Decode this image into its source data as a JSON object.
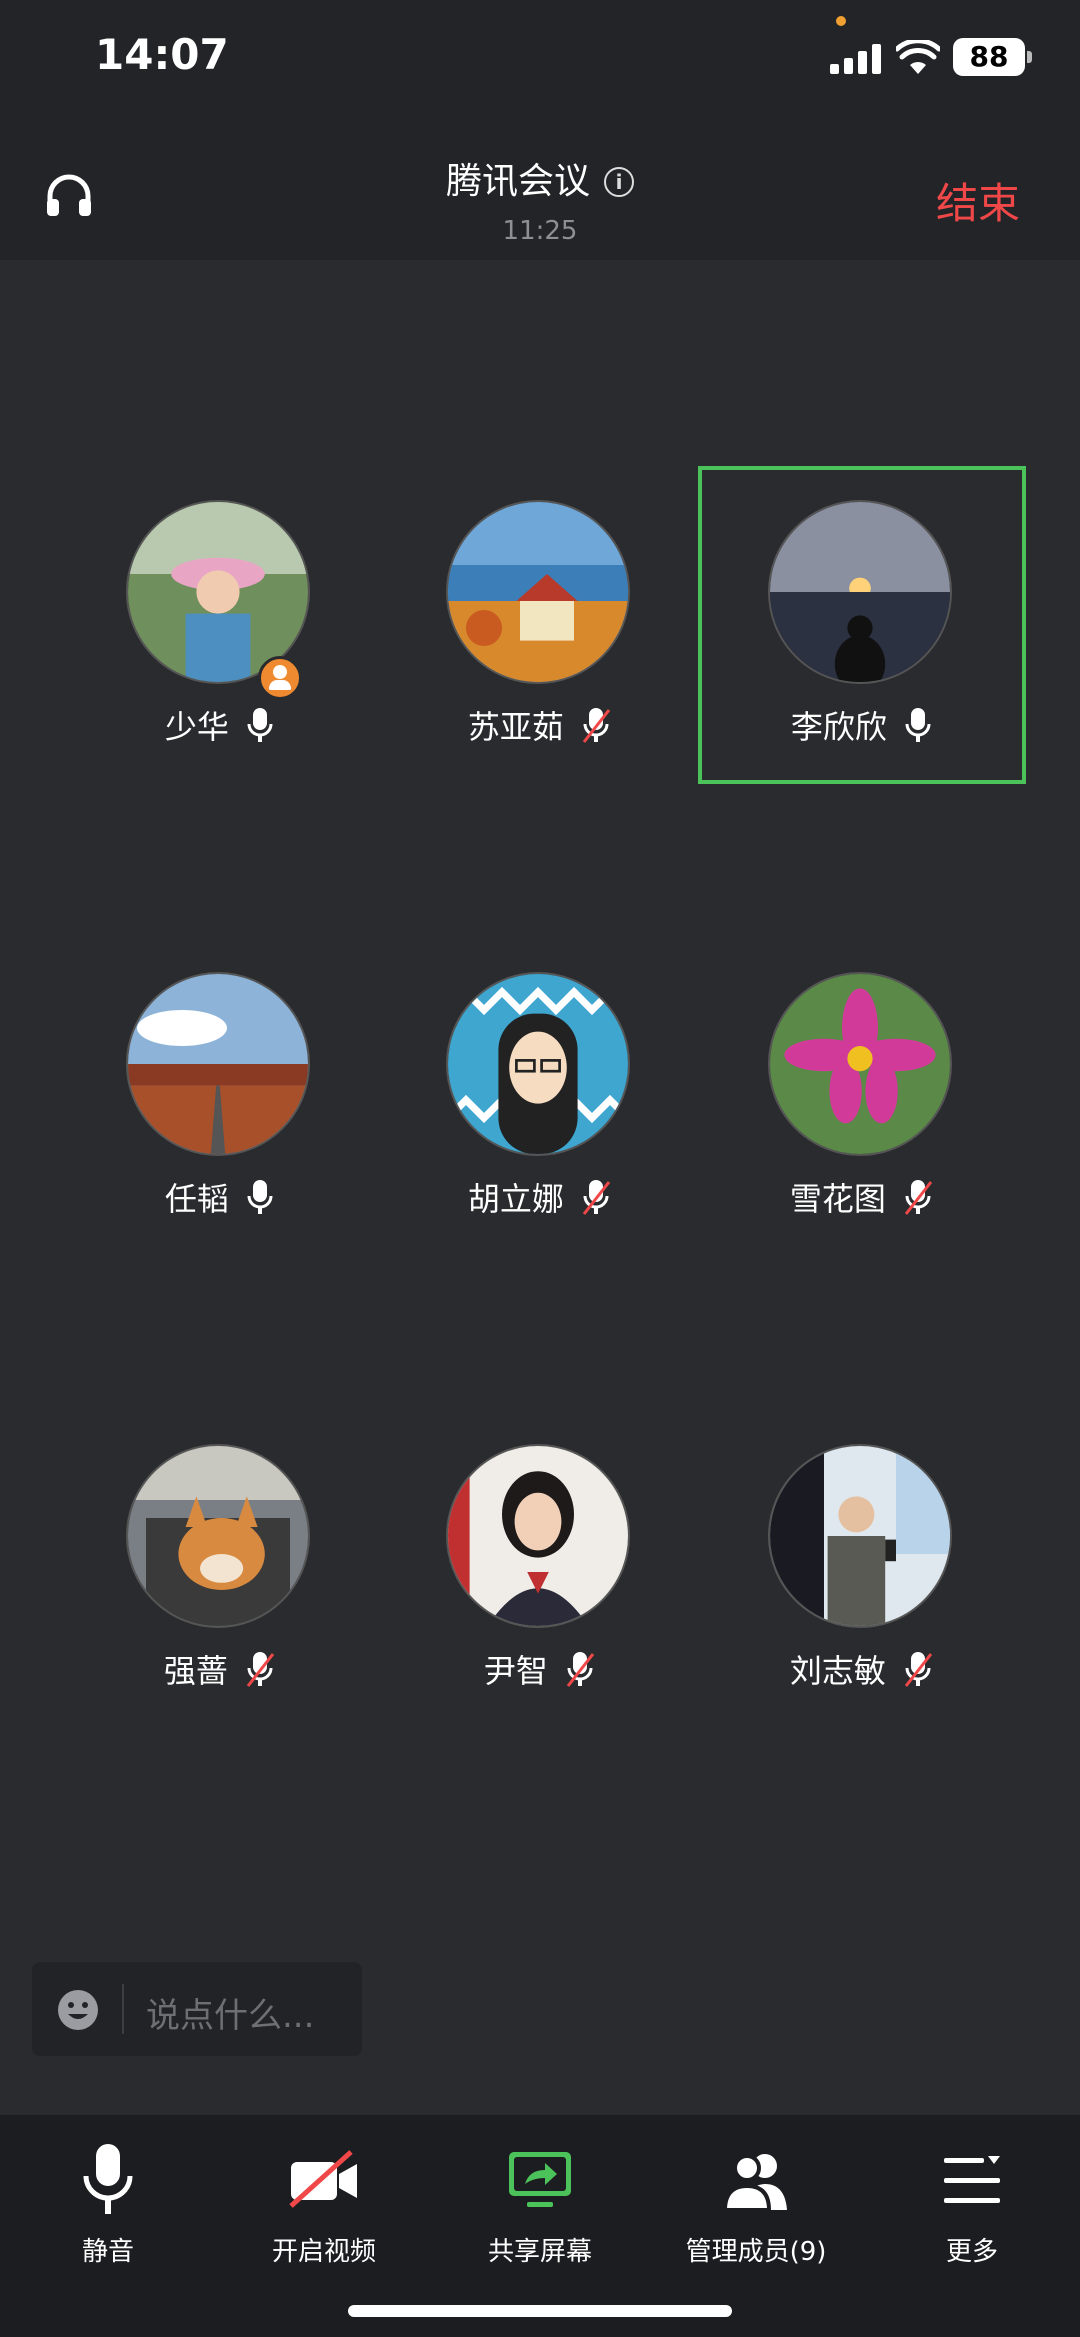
{
  "status": {
    "time": "14:07",
    "battery": "88"
  },
  "header": {
    "title": "腾讯会议",
    "duration": "11:25",
    "end_label": "结束"
  },
  "members": [
    {
      "name": "少华",
      "muted": false,
      "host": true,
      "active": false,
      "avatar": "woman-pink-hat"
    },
    {
      "name": "苏亚茹",
      "muted": true,
      "host": false,
      "active": false,
      "avatar": "painting-village"
    },
    {
      "name": "李欣欣",
      "muted": false,
      "host": false,
      "active": true,
      "avatar": "sunset-lake"
    },
    {
      "name": "任韬",
      "muted": false,
      "host": false,
      "active": false,
      "avatar": "desert-road"
    },
    {
      "name": "胡立娜",
      "muted": true,
      "host": false,
      "active": false,
      "avatar": "cartoon-girl"
    },
    {
      "name": "雪花图",
      "muted": true,
      "host": false,
      "active": false,
      "avatar": "pink-flower"
    },
    {
      "name": "强蔷",
      "muted": true,
      "host": false,
      "active": false,
      "avatar": "corgi-dog"
    },
    {
      "name": "尹智",
      "muted": true,
      "host": false,
      "active": false,
      "avatar": "woman-portrait"
    },
    {
      "name": "刘志敏",
      "muted": true,
      "host": false,
      "active": false,
      "avatar": "man-speaking"
    }
  ],
  "chat": {
    "placeholder": "说点什么..."
  },
  "toolbar": {
    "mute_label": "静音",
    "video_label": "开启视频",
    "share_label": "共享屏幕",
    "members_label": "管理成员(9)",
    "more_label": "更多"
  },
  "colors": {
    "accent_green": "#4cc35a",
    "end_red": "#f04848",
    "host_orange": "#f08a30"
  }
}
